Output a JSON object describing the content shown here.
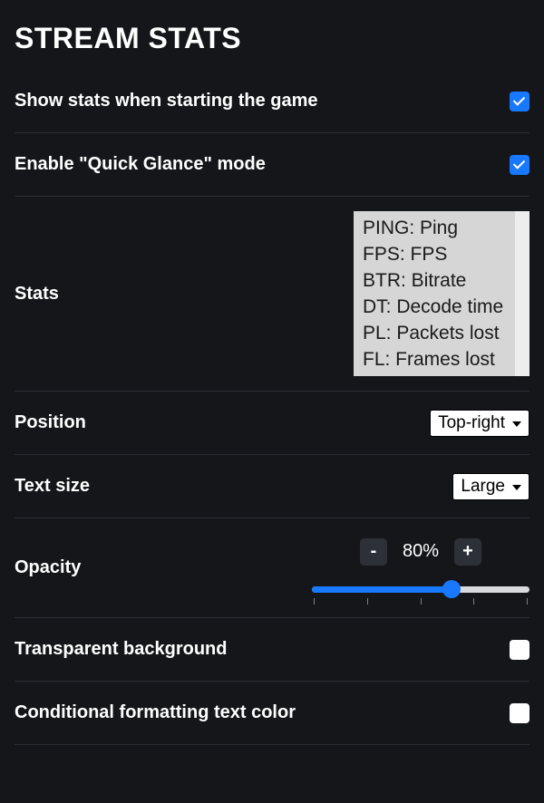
{
  "title": "STREAM STATS",
  "rows": {
    "show_on_start": {
      "label": "Show stats when starting the game",
      "checked": true
    },
    "quick_glance": {
      "label": "Enable \"Quick Glance\" mode",
      "checked": true
    },
    "stats": {
      "label": "Stats",
      "items": [
        "PING: Ping",
        "FPS: FPS",
        "BTR: Bitrate",
        "DT: Decode time",
        "PL: Packets lost",
        "FL: Frames lost"
      ]
    },
    "position": {
      "label": "Position",
      "value": "Top-right"
    },
    "text_size": {
      "label": "Text size",
      "value": "Large"
    },
    "opacity": {
      "label": "Opacity",
      "minus": "-",
      "plus": "+",
      "value_display": "80%",
      "value_percent": 80,
      "slider_fill_percent": 64
    },
    "transparent_bg": {
      "label": "Transparent background",
      "checked": false
    },
    "cond_fmt": {
      "label": "Conditional formatting text color",
      "checked": false
    }
  }
}
